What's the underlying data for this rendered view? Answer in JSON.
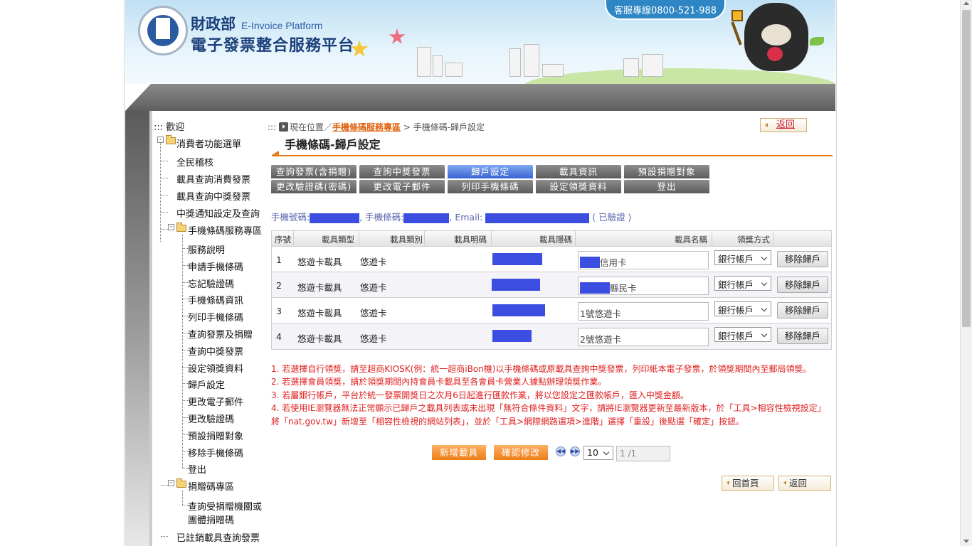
{
  "header": {
    "org_name": "財政部",
    "org_name_en": "E-Invoice Platform",
    "platform_name": "電子發票整合服務平台",
    "service_hotline": "客服專線0800-521-988"
  },
  "sidebar": {
    "welcome": "::: 歡迎",
    "consumer_menu": "消費者功能選單",
    "items_top": [
      "全民稽核",
      "載具查詢消費發票",
      "載具查詢中獎發票",
      "中獎通知設定及查詢"
    ],
    "mobile_section": "手機條碼服務專區",
    "mobile_items": [
      "服務說明",
      "申請手機條碼",
      "忘記驗證碼",
      "手機條碼資訊",
      "列印手機條碼",
      "查詢發票及捐贈",
      "查詢中獎發票",
      "設定領獎資料",
      "歸戶設定",
      "更改電子郵件",
      "更改驗證碼",
      "預設捐贈對象",
      "移除手機條碼",
      "登出"
    ],
    "donation_section": "捐贈碼專區",
    "donation_items": [
      "查詢受捐贈機關或",
      "團體捐贈碼"
    ],
    "bottom_item": "已註銷載具查詢發票"
  },
  "breadcrumb": {
    "prefix": ":::",
    "current_label": "現在位置／",
    "link": "手機條碼服務專區",
    "separator": " > ",
    "page": "手機條碼-歸戶設定"
  },
  "back_top": "返回",
  "page_title": "手機條碼-歸戶設定",
  "tabs": [
    {
      "label": "查詢發票(含捐贈)"
    },
    {
      "label": "查詢中獎發票"
    },
    {
      "label": "歸戶設定",
      "active": true
    },
    {
      "label": "載具資訊"
    },
    {
      "label": "預設捐贈對象"
    },
    {
      "label": "更改驗證碼(密碼)"
    },
    {
      "label": "更改電子郵件"
    },
    {
      "label": "列印手機條碼"
    },
    {
      "label": "設定領獎資料"
    },
    {
      "label": "登出"
    }
  ],
  "info": {
    "phone_label": "手機號碼:",
    "barcode_label": ", 手機條碼:",
    "email_label": ", Email:",
    "verified": "( 已驗證 )"
  },
  "table": {
    "headers": [
      "序號",
      "載具類型",
      "載具類別",
      "載具明碼",
      "載具隱碼",
      "載具名稱",
      "領獎方式"
    ],
    "rows": [
      {
        "no": "1",
        "type": "悠遊卡載具",
        "category": "悠遊卡",
        "name": "信用卡",
        "prize": "銀行帳戶",
        "remove": "移除歸戶"
      },
      {
        "no": "2",
        "type": "悠遊卡載具",
        "category": "悠遊卡",
        "name": "縣民卡",
        "prize": "銀行帳戶",
        "remove": "移除歸戶"
      },
      {
        "no": "3",
        "type": "悠遊卡載具",
        "category": "悠遊卡",
        "name": "1號悠遊卡",
        "prize": "銀行帳戶",
        "remove": "移除歸戶"
      },
      {
        "no": "4",
        "type": "悠遊卡載具",
        "category": "悠遊卡",
        "name": "2號悠遊卡",
        "prize": "銀行帳戶",
        "remove": "移除歸戶"
      }
    ]
  },
  "notes": [
    "1. 若選擇自行領獎，請至超商KIOSK(例：統一超商iBon機)以手機條碼或原載具查詢中獎發票，列印紙本電子發票，於領獎期間內至郵局領獎。",
    "2. 若選擇會員領獎，請於領獎期間內持會員卡載具至各會員卡營業人據點辦理領獎作業。",
    "3. 若屬銀行帳戶，平台於統一發票開獎日之次月6日起進行匯款作業，將以您設定之匯款帳戶，匯入中獎金額。",
    "4. 若使用IE瀏覽器無法正常顯示已歸戶之載具列表或未出現「無符合條件資料」文字，請將IE瀏覽器更新至最新版本，於「工具>相容性檢視設定」將「nat.gov.tw」新增至「相容性檢視的網站列表」，並於「工具>網際網路選項>進階」選擇「重設」後點選「確定」按鈕。"
  ],
  "actions": {
    "add_carrier": "新增載具",
    "confirm": "確認修改",
    "page_size": "10",
    "page_info": "1 /1",
    "home": "回首頁",
    "back": "返回"
  }
}
